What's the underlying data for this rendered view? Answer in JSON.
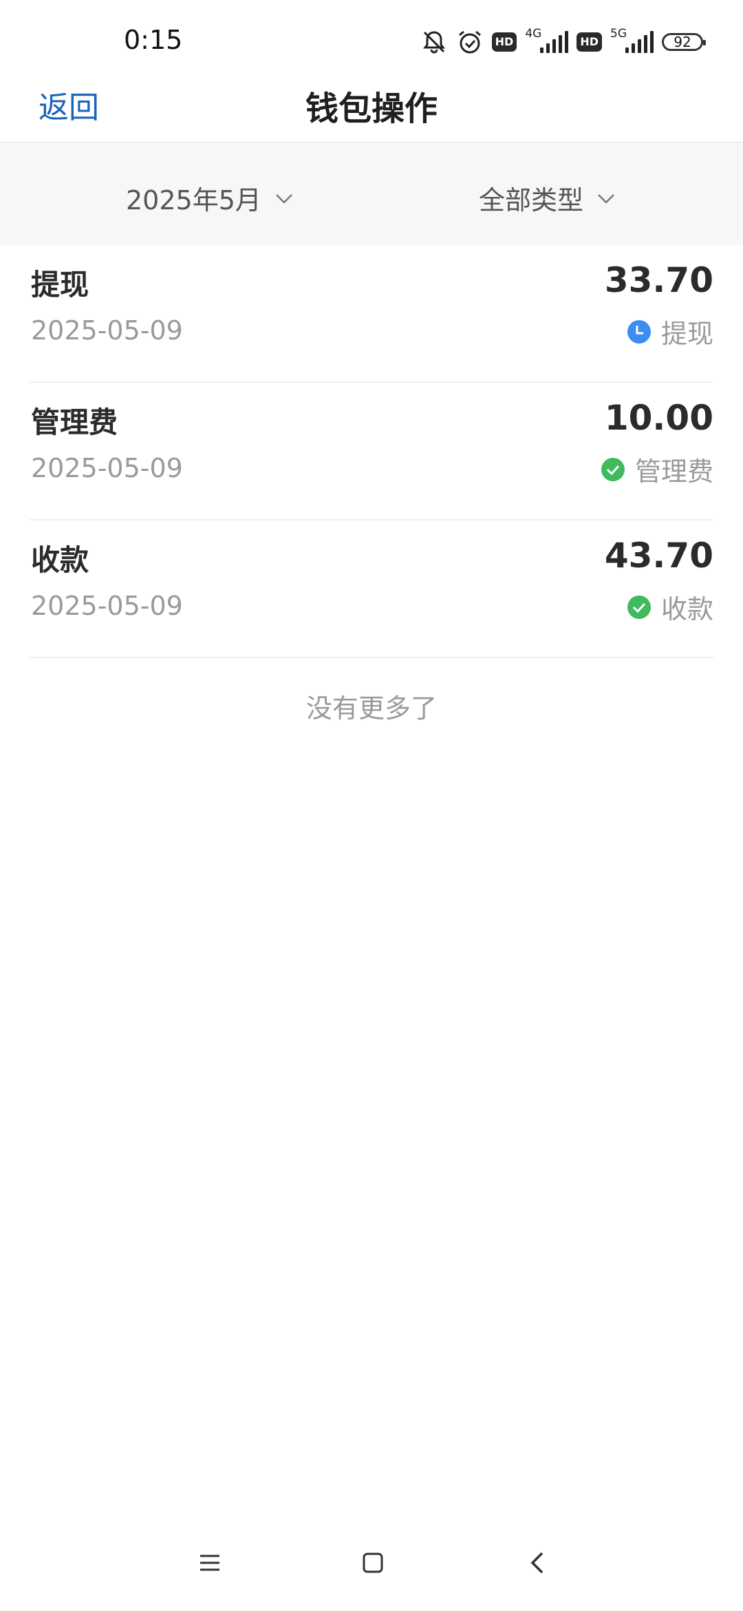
{
  "status_bar": {
    "time": "0:15",
    "icons": [
      "mute-bell-icon",
      "alarm-icon",
      "hd-icon",
      "4g-signal-icon",
      "hd-icon",
      "5g-signal-icon",
      "battery-icon"
    ],
    "hd_label": "HD",
    "net1": "4G",
    "net2": "5G",
    "battery": "92"
  },
  "navbar": {
    "back_label": "返回",
    "title": "钱包操作"
  },
  "filters": {
    "date_label": "2025年5月",
    "type_label": "全部类型"
  },
  "records": [
    {
      "title": "提现",
      "date": "2025-05-09",
      "amount": "33.70",
      "status_label": "提现",
      "status_icon": "clock-icon",
      "status_color": "#3a8ef0"
    },
    {
      "title": "管理费",
      "date": "2025-05-09",
      "amount": "10.00",
      "status_label": "管理费",
      "status_icon": "check-circle-icon",
      "status_color": "#3fba5c"
    },
    {
      "title": "收款",
      "date": "2025-05-09",
      "amount": "43.70",
      "status_label": "收款",
      "status_icon": "check-circle-icon",
      "status_color": "#3fba5c"
    }
  ],
  "list_end_text": "没有更多了",
  "colors": {
    "accent": "#1a64b8",
    "filter_bg": "#f7f7f7"
  }
}
